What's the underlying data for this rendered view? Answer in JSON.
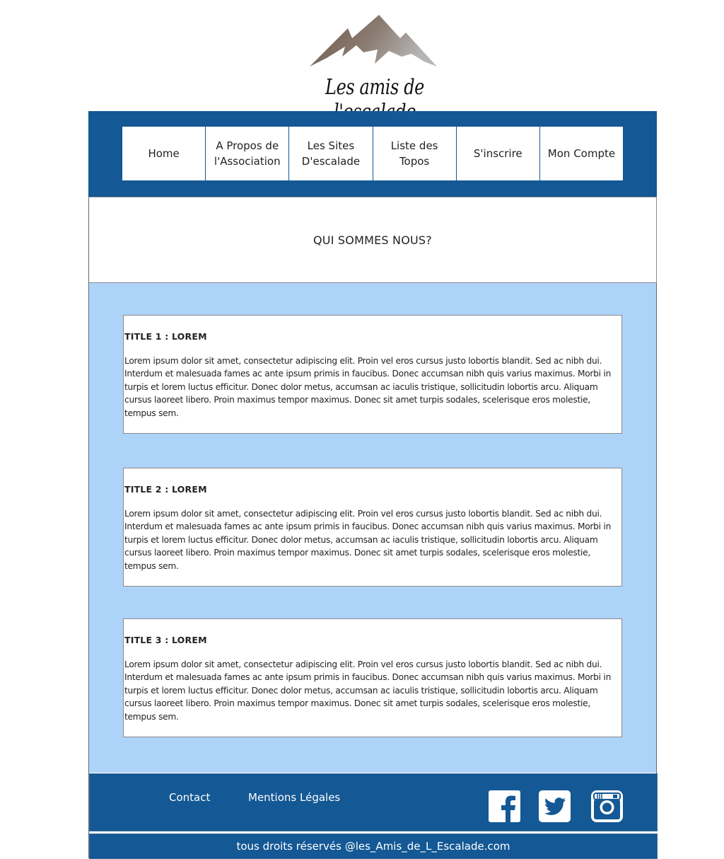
{
  "logo": {
    "text": "Les amis de l'escalade",
    "icon": "mountain-icon",
    "colors": [
      "#6e5647",
      "#a8a8a8"
    ]
  },
  "nav": {
    "items": [
      {
        "label": "Home"
      },
      {
        "label": "A Propos de\nl'Association"
      },
      {
        "label": "Les Sites\nD'escalade"
      },
      {
        "label": "Liste des\nTopos"
      },
      {
        "label": "S'inscrire"
      },
      {
        "label": "Mon Compte"
      }
    ]
  },
  "heading": {
    "title": "QUI SOMMES NOUS?"
  },
  "cards": [
    {
      "title": "TITLE 1 : LOREM",
      "body": "Lorem ipsum dolor sit amet, consectetur adipiscing elit. Proin vel eros cursus justo lobortis blandit. Sed ac nibh dui. Interdum et malesuada fames ac ante ipsum primis in faucibus. Donec accumsan nibh quis varius maximus. Morbi in turpis et lorem luctus efficitur. Donec dolor metus, accumsan ac iaculis tristique, sollicitudin lobortis arcu. Aliquam cursus laoreet libero. Proin maximus tempor maximus. Donec sit amet turpis sodales, scelerisque eros molestie, tempus sem."
    },
    {
      "title": "TITLE 2 : LOREM",
      "body": "Lorem ipsum dolor sit amet, consectetur adipiscing elit. Proin vel eros cursus justo lobortis blandit. Sed ac nibh dui. Interdum et malesuada fames ac ante ipsum primis in faucibus. Donec accumsan nibh quis varius maximus. Morbi in turpis et lorem luctus efficitur. Donec dolor metus, accumsan ac iaculis tristique, sollicitudin lobortis arcu. Aliquam cursus laoreet libero. Proin maximus tempor maximus. Donec sit amet turpis sodales, scelerisque eros molestie, tempus sem."
    },
    {
      "title": "TITLE 3 : LOREM",
      "body": "Lorem ipsum dolor sit amet, consectetur adipiscing elit. Proin vel eros cursus justo lobortis blandit. Sed ac nibh dui. Interdum et malesuada fames ac ante ipsum primis in faucibus. Donec accumsan nibh quis varius maximus. Morbi in turpis et lorem luctus efficitur. Donec dolor metus, accumsan ac iaculis tristique, sollicitudin lobortis arcu. Aliquam cursus laoreet libero. Proin maximus tempor maximus. Donec sit amet turpis sodales, scelerisque eros molestie, tempus sem."
    }
  ],
  "footer": {
    "links": [
      {
        "label": "Contact"
      },
      {
        "label": "Mentions Légales"
      }
    ],
    "social": [
      {
        "icon": "facebook-icon"
      },
      {
        "icon": "twitter-icon"
      },
      {
        "icon": "instagram-icon"
      }
    ],
    "copyright": "tous droits réservés @les_Amis_de_L_Escalade.com"
  },
  "colors": {
    "primary": "#145895",
    "content_bg": "#aed3f9",
    "card_bg": "#ffffff",
    "text": "#222222"
  }
}
